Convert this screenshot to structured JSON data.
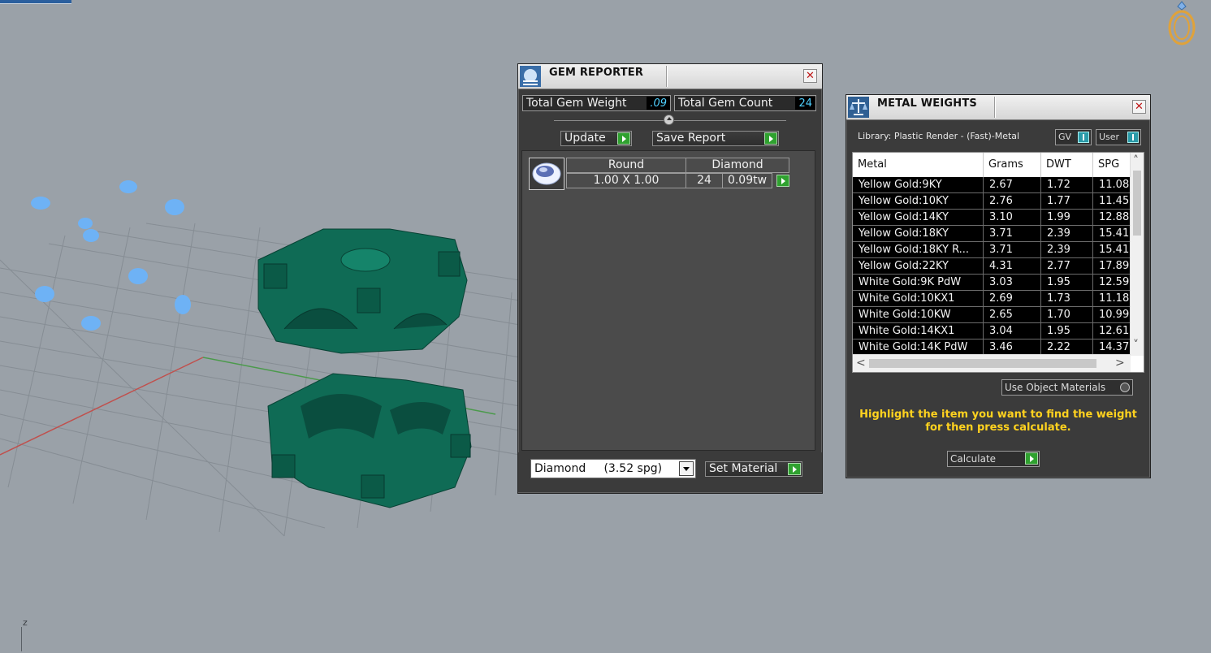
{
  "viewport": {
    "axis_label": "z",
    "model_color": "#0f6b55",
    "gem_marker_color": "#6eb2f5"
  },
  "gem_reporter": {
    "title": "GEM REPORTER",
    "close_icon": "close-icon",
    "total_gem_weight_label": "Total Gem Weight",
    "total_gem_weight_value": ".09",
    "total_gem_count_label": "Total Gem Count",
    "total_gem_count_value": "24",
    "update_label": "Update",
    "save_report_label": "Save Report",
    "gems": [
      {
        "shape": "Round",
        "material": "Diamond",
        "size": "1.00 X 1.00",
        "count": "24",
        "weight": "0.09tw"
      }
    ],
    "material_select_value": "Diamond     (3.52 spg)",
    "set_material_label": "Set Material"
  },
  "metal_weights": {
    "title": "METAL WEIGHTS",
    "library_text": "Library: Plastic Render - (Fast)-Metal",
    "gv_label": "GV",
    "user_label": "User",
    "columns": [
      "Metal",
      "Grams",
      "DWT",
      "SPG"
    ],
    "rows": [
      [
        "Yellow Gold:9KY",
        "2.67",
        "1.72",
        "11.08"
      ],
      [
        "Yellow Gold:10KY",
        "2.76",
        "1.77",
        "11.45"
      ],
      [
        "Yellow Gold:14KY",
        "3.10",
        "1.99",
        "12.88"
      ],
      [
        "Yellow Gold:18KY",
        "3.71",
        "2.39",
        "15.41"
      ],
      [
        "Yellow Gold:18KY R...",
        "3.71",
        "2.39",
        "15.41"
      ],
      [
        "Yellow Gold:22KY",
        "4.31",
        "2.77",
        "17.89"
      ],
      [
        "White Gold:9K PdW",
        "3.03",
        "1.95",
        "12.59"
      ],
      [
        "White Gold:10KX1",
        "2.69",
        "1.73",
        "11.18"
      ],
      [
        "White Gold:10KW",
        "2.65",
        "1.70",
        "10.99"
      ],
      [
        "White Gold:14KX1",
        "3.04",
        "1.95",
        "12.61"
      ],
      [
        "White Gold:14K PdW",
        "3.46",
        "2.22",
        "14.37"
      ]
    ],
    "use_object_materials_label": "Use Object Materials",
    "hint_text": "Highlight the item you want to find the weight for then press calculate.",
    "calculate_label": "Calculate"
  }
}
